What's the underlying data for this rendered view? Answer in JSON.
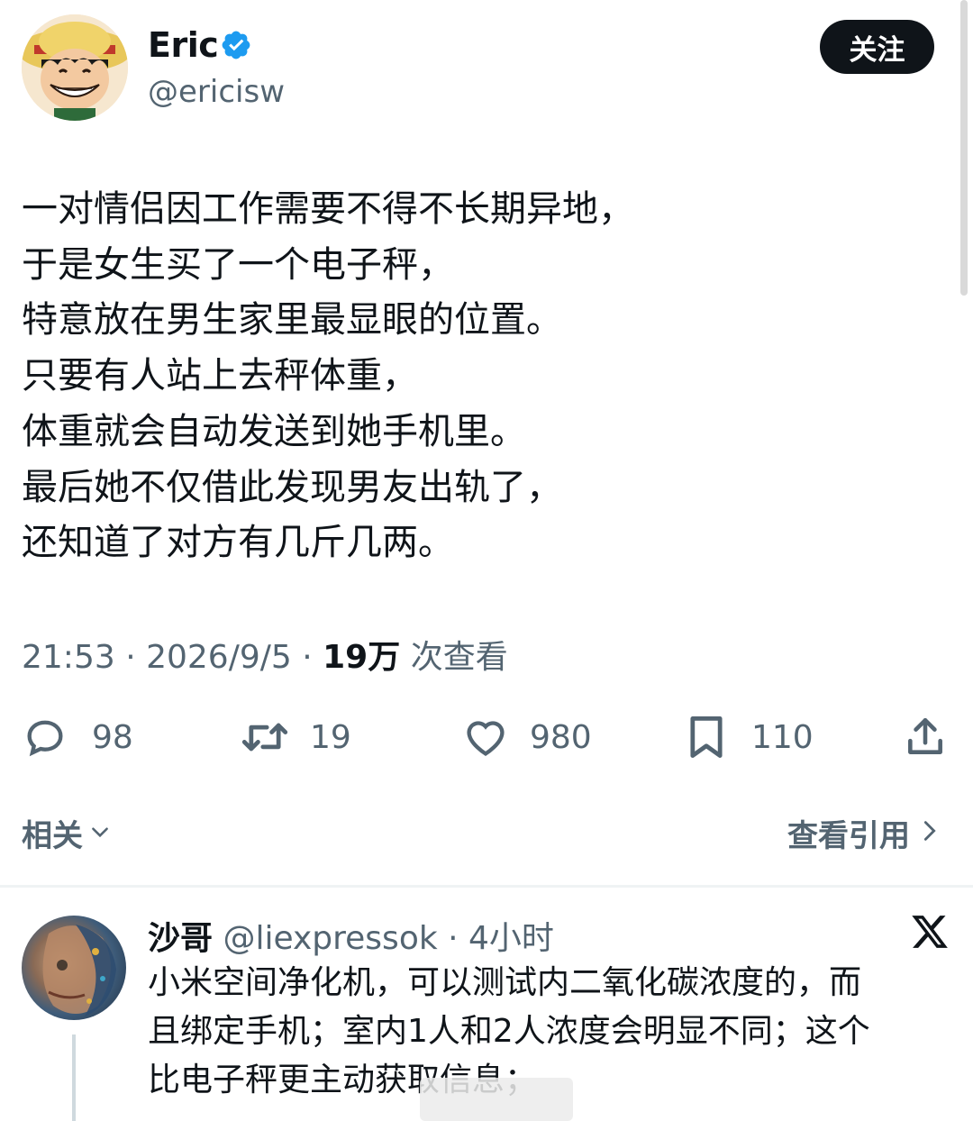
{
  "author": {
    "name": "Eric",
    "handle": "@ericisw",
    "verified": true,
    "follow_label": "关注"
  },
  "tweet": {
    "lines": [
      "一对情侣因工作需要不得不长期异地，",
      "于是女生买了一个电子秤，",
      "特意放在男生家里最显眼的位置。",
      "只要有人站上去秤体重，",
      "体重就会自动发送到她手机里。",
      "最后她不仅借此发现男友出轨了，",
      "还知道了对方有几斤几两。"
    ],
    "time": "21:53",
    "date": "2026/9/5",
    "views": "19万",
    "views_label": "次查看"
  },
  "actions": {
    "replies": "98",
    "retweets": "19",
    "likes": "980",
    "bookmarks": "110"
  },
  "related_label": "相关",
  "quotes_label": "查看引用",
  "reply": {
    "name": "沙哥",
    "handle": "@liexpressok",
    "time": "4小时",
    "lines": [
      "小米空间净化机，可以测试内二氧化碳浓度的，而",
      "且绑定手机；室内1人和2人浓度会明显不同；这个",
      "比电子秤更主动获取信息；"
    ]
  },
  "colors": {
    "text": "#0f1419",
    "secondary": "#536471",
    "verified": "#1d9bf0",
    "divider": "#eff3f4"
  },
  "icons": [
    "verified-badge-icon",
    "reply-icon",
    "retweet-icon",
    "like-icon",
    "bookmark-icon",
    "share-icon",
    "chevron-down-icon",
    "chevron-right-icon",
    "x-logo-icon"
  ]
}
